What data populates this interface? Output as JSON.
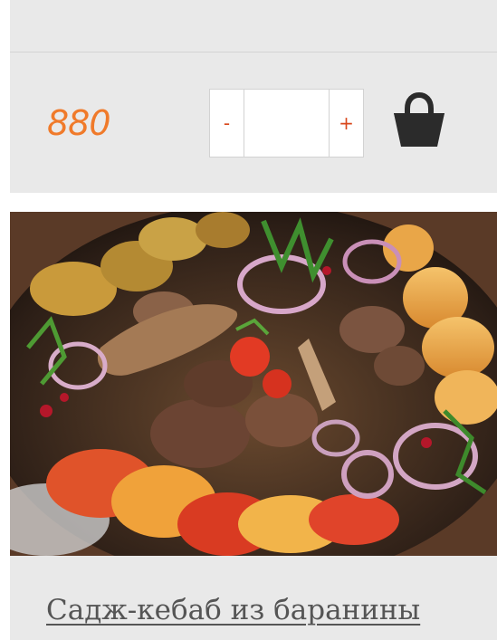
{
  "product": {
    "price": "880",
    "quantity": {
      "minus_label": "-",
      "plus_label": "+",
      "value": ""
    },
    "cart_icon": "shopping-basket-icon",
    "image": "sadzh-kebab-photo",
    "title": "Садж-кебаб из баранины"
  },
  "colors": {
    "card_background": "#e9e9e9",
    "price": "#f07a2a",
    "qty_button_text": "#d9471b",
    "cart_icon": "#2b2b2b",
    "title_link": "#555555"
  }
}
